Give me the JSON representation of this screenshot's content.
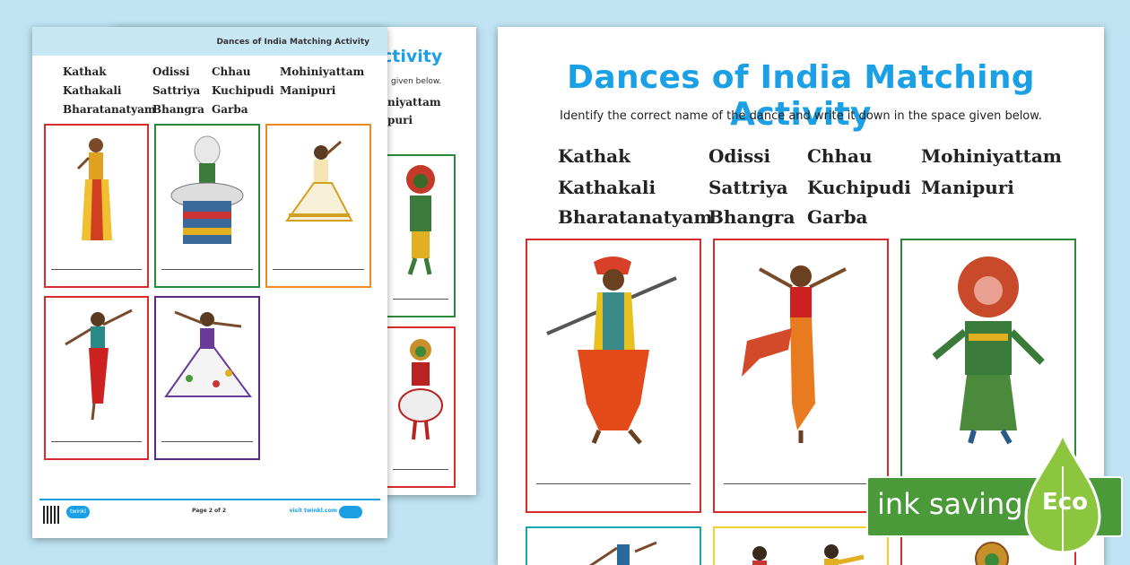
{
  "title": "Dances of India Matching Activity",
  "header_title": "Dances of India Matching Activity",
  "instruction": "Identify the correct name of the dance and write it down in the space given below.",
  "back_title_partial": "ctivity",
  "back_sub_partial": "given below.",
  "back_words": [
    "niyattam",
    "puri"
  ],
  "words": [
    "Kathak",
    "Odissi",
    "Chhau",
    "Mohiniyattam",
    "Kathakali",
    "Sattriya",
    "Kuchipudi",
    "Manipuri",
    "Bharatanatyam",
    "Bhangra",
    "Garba"
  ],
  "footer": {
    "page": "Page 2 of 2",
    "visit": "visit twinkl.com",
    "logo": "twinkl"
  },
  "eco": {
    "text": "ink saving",
    "label": "Eco"
  },
  "colors": {
    "accent": "#1ba0e6",
    "eco_green": "#4a9a3a",
    "background": "#bfe3f2"
  }
}
